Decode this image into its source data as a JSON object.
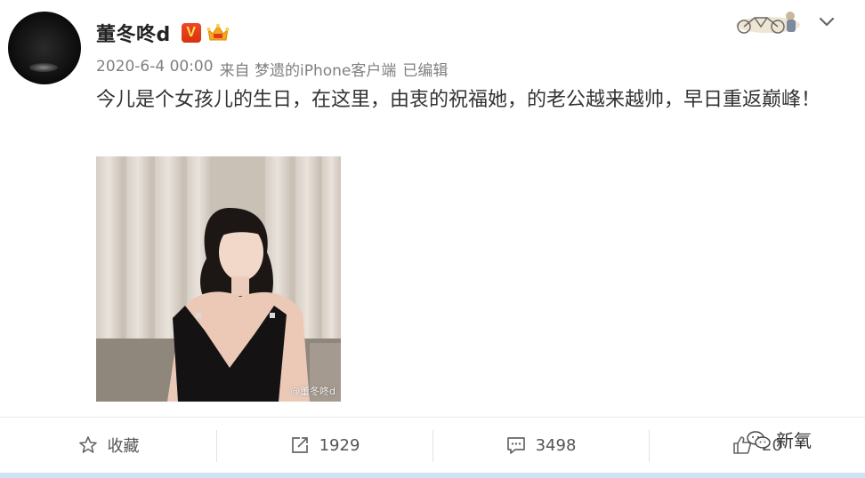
{
  "user": {
    "name": "董冬咚d",
    "verified_badge": "V"
  },
  "meta": {
    "date": "2020-6-4 00:00",
    "source": "来自 梦遗的iPhone客户端",
    "edited": "已编辑"
  },
  "post": {
    "text": "今儿是个女孩儿的生日，在这里，由衷的祝福她，的老公越来越帅，早日重返巅峰！",
    "image_watermark": "@董冬咚d"
  },
  "actions": {
    "favorite_label": "收藏",
    "repost_count": "1929",
    "comment_count": "3498",
    "like_count": "20"
  },
  "overlay": {
    "label": "新氧"
  },
  "colors": {
    "vip_red": "#e03a1a",
    "crown_orange": "#f5a623",
    "bottom_bar": "#cfe3f6"
  },
  "icons": [
    "star-icon",
    "share-icon",
    "comment-icon",
    "thumbs-up-icon",
    "chevron-down-icon",
    "crown-icon",
    "bicycle-decoration-icon",
    "wechat-icon"
  ]
}
